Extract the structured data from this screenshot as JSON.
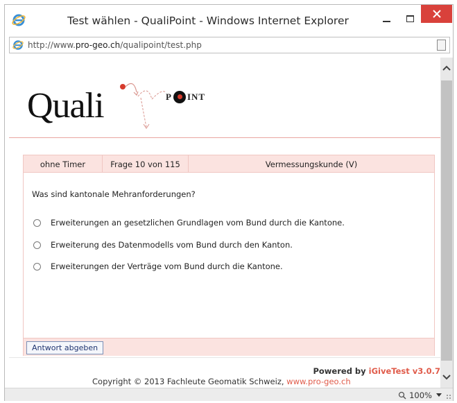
{
  "window": {
    "title": "Test wählen - QualiPoint - Windows Internet Explorer",
    "address_prefix": "http://www.",
    "address_domain": "pro-geo.ch",
    "address_path": "/qualipoint/test.php"
  },
  "logo": {
    "quali": "Quali",
    "point_p": "P",
    "point_rest": "INT"
  },
  "test": {
    "timer": "ohne Timer",
    "progress": "Frage 10 von 115",
    "subject": "Vermessungskunde (V)",
    "question": "Was sind kantonale Mehranforderungen?",
    "answers": [
      "Erweiterungen an gesetzlichen Grundlagen vom Bund durch die Kantone.",
      "Erweiterung des Datenmodells vom Bund durch den Kanton.",
      "Erweiterungen der Verträge vom Bund durch die Kantone."
    ],
    "submit_label": "Antwort abgeben"
  },
  "footer": {
    "powered_prefix": "Powered by ",
    "powered_link": "iGiveTest v3.0.7",
    "copyright_prefix": "Copyright © 2013 Fachleute Geomatik Schweiz, ",
    "copyright_link": "www.pro-geo.ch"
  },
  "status": {
    "zoom": "100%"
  },
  "icons": [
    "ie-logo-icon",
    "minimize-icon",
    "maximize-icon",
    "close-icon",
    "page-icon",
    "scroll-up-icon",
    "scroll-down-icon",
    "zoom-icon",
    "chevron-down-icon",
    "resize-grip-icon"
  ],
  "colors": {
    "accent": "#e05b4a",
    "close_button": "#d9413b",
    "panel_header": "#fbe3e0"
  }
}
